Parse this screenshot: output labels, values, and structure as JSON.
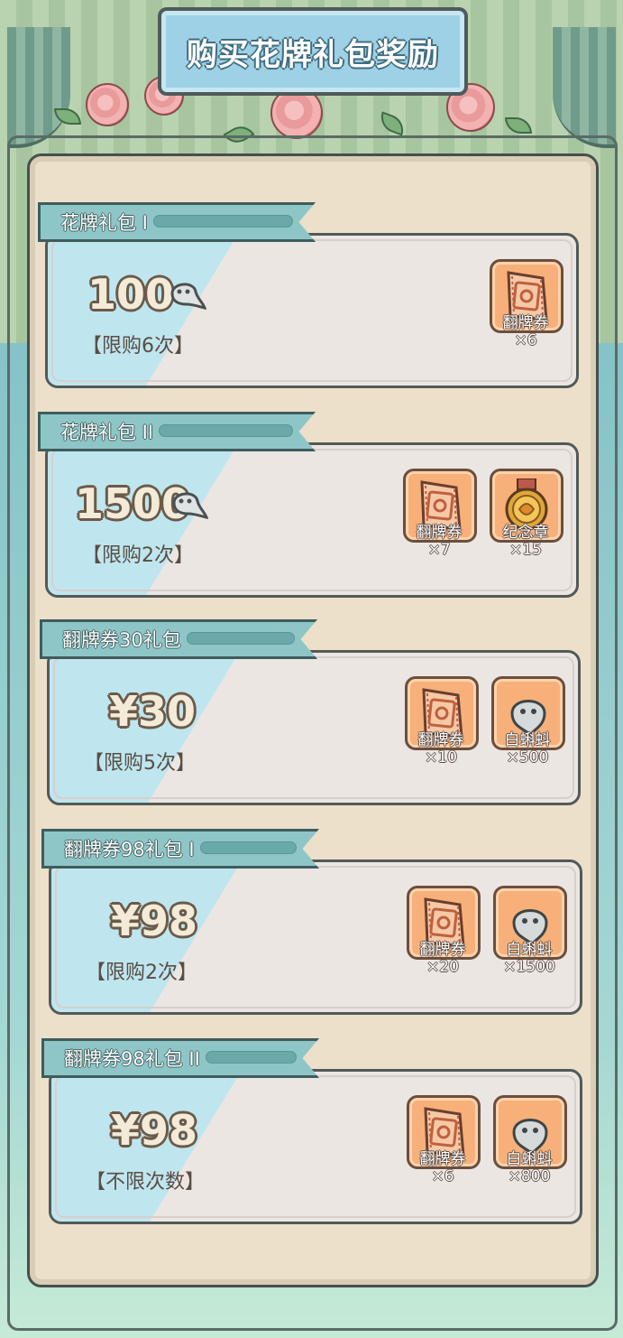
{
  "title": "购买花牌礼包奖励",
  "packs": [
    {
      "name": "花牌礼包 I",
      "price": "100",
      "price_is_currency_icon": true,
      "limit": "【限购6次】",
      "items": [
        {
          "name": "翻牌券",
          "count": "×6",
          "icon": "ticket-icon"
        }
      ]
    },
    {
      "name": "花牌礼包 II",
      "price": "1500",
      "price_is_currency_icon": true,
      "limit": "【限购2次】",
      "items": [
        {
          "name": "翻牌券",
          "count": "×7",
          "icon": "ticket-icon"
        },
        {
          "name": "纪念章",
          "count": "×15",
          "icon": "medal-icon"
        }
      ]
    },
    {
      "name": "翻牌券30礼包",
      "price": "¥30",
      "price_is_currency_icon": false,
      "limit": "【限购5次】",
      "items": [
        {
          "name": "翻牌券",
          "count": "×10",
          "icon": "ticket-icon"
        },
        {
          "name": "白蝌蚪",
          "count": "×500",
          "icon": "tadpole-icon"
        }
      ]
    },
    {
      "name": "翻牌券98礼包 I",
      "price": "¥98",
      "price_is_currency_icon": false,
      "limit": "【限购2次】",
      "items": [
        {
          "name": "翻牌券",
          "count": "×20",
          "icon": "ticket-icon"
        },
        {
          "name": "白蝌蚪",
          "count": "×1500",
          "icon": "tadpole-icon"
        }
      ]
    },
    {
      "name": "翻牌券98礼包 II",
      "price": "¥98",
      "price_is_currency_icon": false,
      "limit": "【不限次数】",
      "items": [
        {
          "name": "翻牌券",
          "count": "×6",
          "icon": "ticket-icon"
        },
        {
          "name": "白蝌蚪",
          "count": "×800",
          "icon": "tadpole-icon"
        }
      ]
    }
  ],
  "colors": {
    "panel": "#ece0cb",
    "card": "#ece6e3",
    "ribbon": "#8ec6c8",
    "item_bg": "#f7b07a",
    "title_bg": "#9fd1e6"
  }
}
